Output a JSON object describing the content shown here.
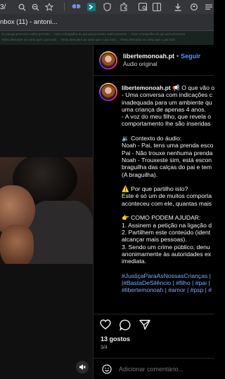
{
  "browser": {
    "url_fragment": "3/",
    "tab_title": "nbox (11) - antoni..."
  },
  "background_page": {
    "line1": "do pai pai processo sobre preceito ... Ative a braguilha do pai pai processo sobre preceito ... Ative a braguilha do pai para processo",
    "line2": "Tento descobrir ao certo que o pai rodo ... Tento descobrir ao certo que o pai rodo ... Tento descobrir ao certo que o pai rodo"
  },
  "post": {
    "username": "libertemonoah.pt",
    "follow_label": "Seguir",
    "audio_label": "Áudio original",
    "caption_username": "libertemonoah.pt",
    "caption_lines": [
      " 📢 O que vão o",
      "- Uma conversa com indicações c",
      "inadequada para um ambiente qu",
      "uma criança de apenas 4 anos.",
      "- A voz do meu filho, que revela o",
      "comportamento lhe são inseridas",
      "",
      "🔉 Contexto do áudio:",
      "Noah - Pai, tens uma prenda esco",
      "Pai - Não trouxe nenhuma prenda",
      "Noah - Trouxeste sim, está escon",
      "braguilha das calças do pai e tem",
      "(A braguilha).",
      "",
      "⚠️ Por que partilho isto?",
      "Este é só um de muitos comporta",
      "aconteceu com ele, quantas mais",
      "",
      "👉 COMO PODEM AJUDAR:",
      "1. Assinem a petição na ligação d",
      "2. Partilhem este conteúdo (ident",
      "alcançar mais pessoas).",
      "3. Sendo um crime público, denu",
      "anonimamente às autoridades ex",
      "imediata."
    ],
    "hashtag_lines": [
      "#JustiçaParaAsNossasCrianças | ",
      "|#BastaDeSilêncio | #filho | #pai | ",
      "#libertemonoah | #amor | #psp | #"
    ],
    "likes": "13 gostos",
    "counter": "3/4",
    "comment_placeholder": "Adicionar comentário..."
  },
  "icons": {
    "search": "search-icon",
    "zoom": "zoom-icon",
    "star": "star-icon",
    "like": "heart-icon",
    "comment": "comment-icon",
    "share": "share-icon",
    "mute": "mute-icon"
  },
  "colors": {
    "follow": "#4d9fff",
    "hashtag": "#7ea9ff",
    "background": "#000000"
  }
}
